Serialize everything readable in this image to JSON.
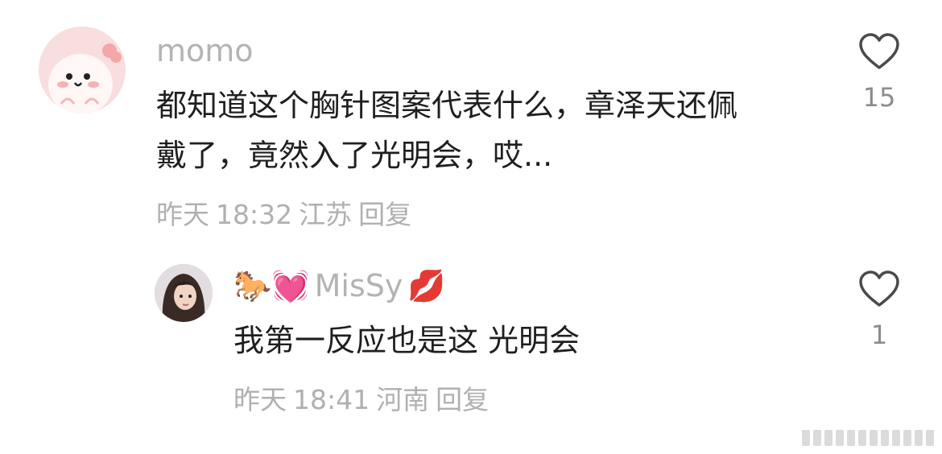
{
  "comments": [
    {
      "username": "momo",
      "text_line1": "都知道这个胸针图案代表什么，章泽天还佩",
      "text_line2": "戴了，竟然入了光明会，哎...",
      "date": "昨天",
      "time": "18:32",
      "location": "江苏",
      "reply_label": "回复",
      "likes": "15"
    },
    {
      "username_emoji_prefix": "🐎💓",
      "username": "MisSy",
      "username_emoji_suffix": "💋",
      "text": "我第一反应也是这 光明会",
      "date": "昨天",
      "time": "18:41",
      "location": "河南",
      "reply_label": "回复",
      "likes": "1"
    }
  ],
  "colors": {
    "username": "#b3b3b3",
    "meta": "#b0b0b0",
    "count": "#8c8c8c",
    "avatar1_bg": "#f9e1e1",
    "heart_stroke": "#4a4a4a"
  },
  "icons": [
    "avatar-cartoon-icon",
    "avatar-photo-icon",
    "heart-outline-icon"
  ]
}
